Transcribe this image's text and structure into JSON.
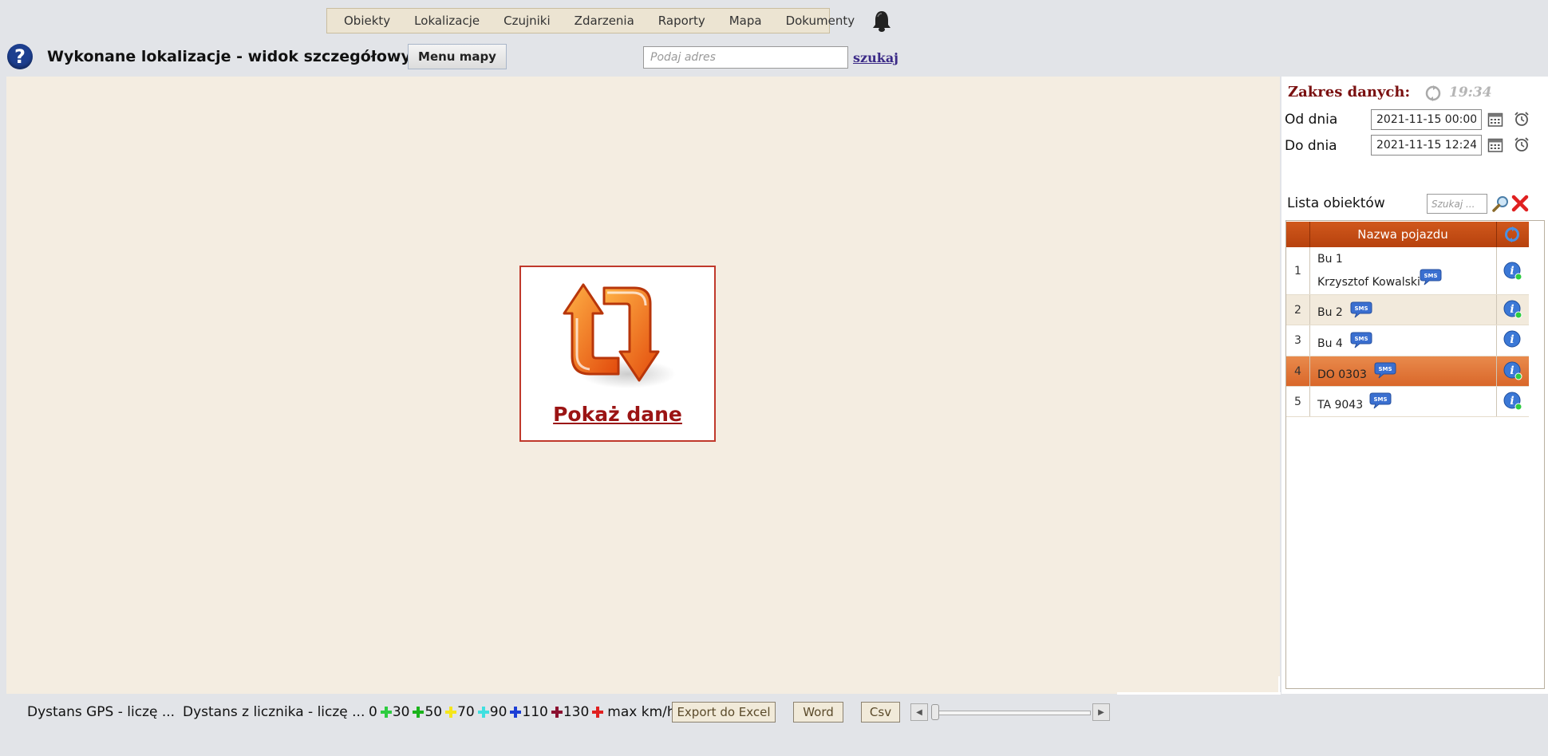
{
  "nav": {
    "items": [
      "Obiekty",
      "Lokalizacje",
      "Czujniki",
      "Zdarzenia",
      "Raporty",
      "Mapa",
      "Dokumenty"
    ]
  },
  "header": {
    "help": "?",
    "title": "Wykonane lokalizacje - widok szczegółowy",
    "menu_mapy": "Menu mapy",
    "address_placeholder": "Podaj adres",
    "search_link": "szukaj"
  },
  "map": {
    "show_data_label": "Pokaż dane"
  },
  "range": {
    "title": "Zakres danych:",
    "time": "19:34",
    "from_label": "Od dnia",
    "from_value": "2021-11-15 00:00",
    "to_label": "Do dnia",
    "to_value": "2021-11-15 12:24"
  },
  "objects": {
    "label": "Lista obiektów",
    "search_placeholder": "Szukaj ...",
    "column_name": "Nazwa pojazdu",
    "rows": [
      {
        "num": "1",
        "name": "Bu 1",
        "driver": "Krzysztof Kowalski"
      },
      {
        "num": "2",
        "name": "Bu 2",
        "driver": ""
      },
      {
        "num": "3",
        "name": "Bu 4",
        "driver": ""
      },
      {
        "num": "4",
        "name": "DO 0303",
        "driver": ""
      },
      {
        "num": "5",
        "name": "TA 9043",
        "driver": ""
      }
    ],
    "selected_index": 3
  },
  "bottom": {
    "dist_gps": "Dystans GPS - liczę ...",
    "dist_counter": "Dystans z licznika - liczę ...",
    "legend": [
      {
        "label": "0",
        "color": ""
      },
      {
        "label": "30",
        "color": "#2ecc40"
      },
      {
        "label": "50",
        "color": "#1bb31b"
      },
      {
        "label": "70",
        "color": "#f5e61c"
      },
      {
        "label": "90",
        "color": "#3fe0e0"
      },
      {
        "label": "110",
        "color": "#1d3fd6"
      },
      {
        "label": "130",
        "color": "#8b1030"
      },
      {
        "label": "max km/h",
        "color": "#e02020"
      }
    ],
    "export_excel": "Export do Excel",
    "word": "Word",
    "csv": "Csv",
    "slider_value": 0
  },
  "colors": {
    "map_bg": "#f4ede1",
    "accent_orange": "#c24a12",
    "title_red": "#7a1010"
  }
}
